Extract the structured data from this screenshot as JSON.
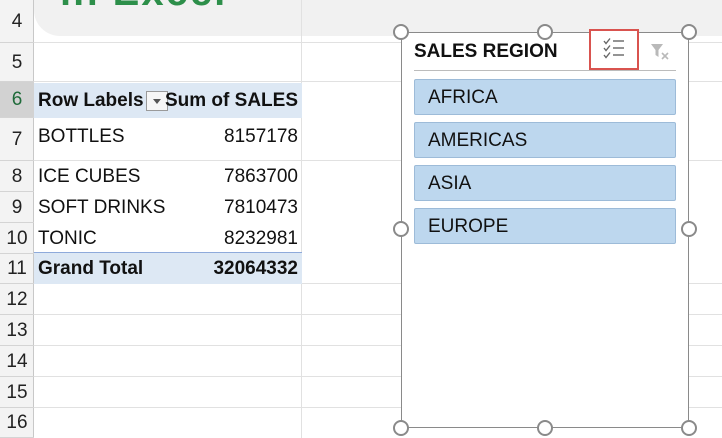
{
  "sheet": {
    "banner_title": "in Excel",
    "rows": [
      "4",
      "5",
      "6",
      "7",
      "8",
      "9",
      "10",
      "11",
      "12",
      "13",
      "14",
      "15",
      "16"
    ],
    "selected_row": "6"
  },
  "pivot": {
    "header": {
      "row_labels": "Row Labels",
      "sum_label": "Sum of SALES"
    },
    "items": [
      {
        "label": "BOTTLES",
        "value": "8157178"
      },
      {
        "label": "ICE CUBES",
        "value": "7863700"
      },
      {
        "label": "SOFT DRINKS",
        "value": "7810473"
      },
      {
        "label": "TONIC",
        "value": "8232981"
      }
    ],
    "total": {
      "label": "Grand Total",
      "value": "32064332"
    }
  },
  "slicer": {
    "title": "SALES REGION",
    "items": [
      "AFRICA",
      "AMERICAS",
      "ASIA",
      "EUROPE"
    ],
    "multi_select_icon": "multi-select-checklist-icon",
    "clear_filter_icon": "clear-filter-icon",
    "highlight_color": "#d9534f",
    "item_color": "#bdd7ee"
  }
}
